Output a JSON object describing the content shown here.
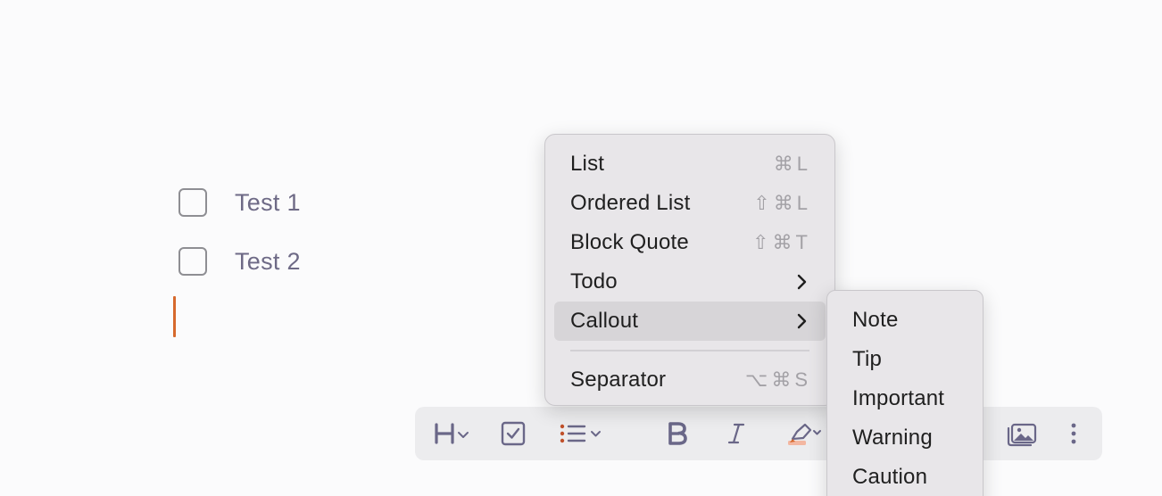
{
  "todos": [
    {
      "label": "Test 1",
      "checked": false
    },
    {
      "label": "Test 2",
      "checked": false
    }
  ],
  "menu": {
    "items": [
      {
        "label": "List",
        "shortcut": "⌘L"
      },
      {
        "label": "Ordered List",
        "shortcut": "⇧⌘L"
      },
      {
        "label": "Block Quote",
        "shortcut": "⇧⌘T"
      },
      {
        "label": "Todo",
        "submenu": true
      },
      {
        "label": "Callout",
        "submenu": true,
        "highlighted": true
      },
      {
        "label": "Separator",
        "shortcut": "⌥⌘S"
      }
    ]
  },
  "submenu": {
    "items": [
      {
        "label": "Note"
      },
      {
        "label": "Tip"
      },
      {
        "label": "Important"
      },
      {
        "label": "Warning"
      },
      {
        "label": "Caution"
      }
    ]
  },
  "toolbar": {
    "heading_icon": "heading-icon",
    "todo_icon": "checkbox-icon",
    "list_icon": "bulleted-list-icon",
    "bold_icon": "bold-icon",
    "italic_icon": "italic-icon",
    "highlight_icon": "highlighter-icon",
    "image_icon": "image-icon",
    "more_icon": "more-icon"
  },
  "colors": {
    "caret": "#d6692d",
    "toolbar_icon": "#6a6788",
    "menu_bg": "#e8e6e9",
    "highlight_bg": "#d7d5d8"
  }
}
